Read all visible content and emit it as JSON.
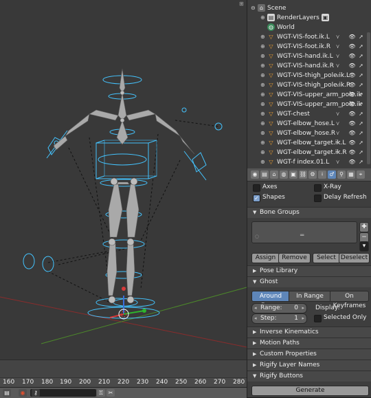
{
  "outliner": {
    "scene": "Scene",
    "render_layers": "RenderLayers",
    "world": "World",
    "items": [
      {
        "label": "WGT-VIS-foot.ik.L"
      },
      {
        "label": "WGT-VIS-foot.ik.R"
      },
      {
        "label": "WGT-VIS-hand.ik.L"
      },
      {
        "label": "WGT-VIS-hand.ik.R"
      },
      {
        "label": "WGT-VIS-thigh_pole.ik.L"
      },
      {
        "label": "WGT-VIS-thigh_pole.ik.R"
      },
      {
        "label": "WGT-VIS-upper_arm_pole.ik"
      },
      {
        "label": "WGT-VIS-upper_arm_pole.ik"
      },
      {
        "label": "WGT-chest"
      },
      {
        "label": "WGT-elbow_hose.L"
      },
      {
        "label": "WGT-elbow_hose.R"
      },
      {
        "label": "WGT-elbow_target.ik.L"
      },
      {
        "label": "WGT-elbow_target.ik.R"
      },
      {
        "label": "WGT-f index.01.L"
      }
    ]
  },
  "display": {
    "axes": "Axes",
    "xray": "X-Ray",
    "shapes": "Shapes",
    "delay_refresh": "Delay Refresh"
  },
  "bone_groups": {
    "title": "Bone Groups",
    "assign": "Assign",
    "remove": "Remove",
    "select": "Select",
    "deselect": "Deselect"
  },
  "pose_library": {
    "title": "Pose Library"
  },
  "ghost": {
    "title": "Ghost",
    "modes": [
      "Around Frame",
      "In Range",
      "On Keyframes"
    ],
    "active_mode": "Around Frame",
    "range_label": "Range:",
    "range_value": "0",
    "step_label": "Step:",
    "step_value": "1",
    "display_label": "Display:",
    "selected_only": "Selected Only"
  },
  "panels": [
    {
      "title": "Inverse Kinematics"
    },
    {
      "title": "Motion Paths"
    },
    {
      "title": "Custom Properties"
    },
    {
      "title": "Rigify Layer Names"
    },
    {
      "title": "Rigify Buttons"
    }
  ],
  "generate": "Generate",
  "timeline": {
    "ticks": [
      "160",
      "170",
      "180",
      "190",
      "200",
      "210",
      "220",
      "230",
      "240",
      "250",
      "260",
      "270",
      "280"
    ]
  },
  "colors": {
    "viewport_bg": "#393939",
    "bone": "#a9a9a9",
    "widget": "#44c4ff",
    "active_tab": "#5e86b9",
    "x_axis": "#8b2c2c",
    "y_axis": "#4d8a2a"
  }
}
